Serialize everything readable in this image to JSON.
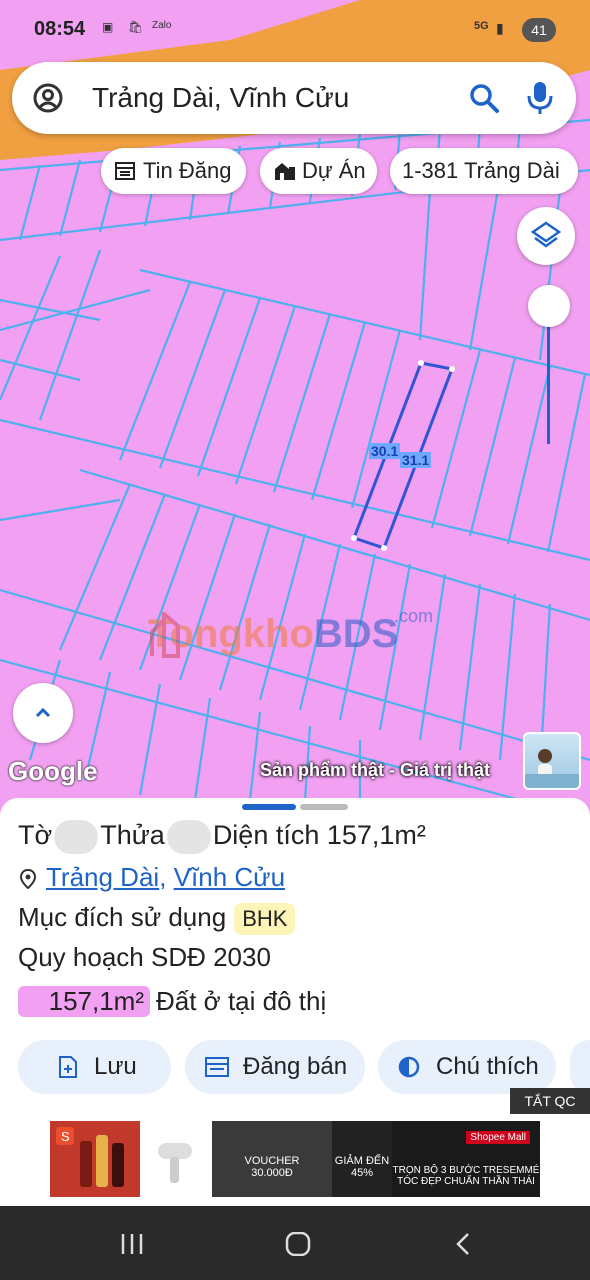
{
  "status_bar": {
    "time": "08:54",
    "notification_icons": [
      "screenshot-icon",
      "shopee-icon",
      "zalo-icon"
    ],
    "signal": "5G",
    "battery": "41"
  },
  "search": {
    "query": "Trảng Dài, Vĩnh Cửu",
    "icons": [
      "account-icon",
      "search-icon",
      "mic-icon"
    ]
  },
  "chips": {
    "tin_dang": "Tin Đăng",
    "du_an": "Dự Án",
    "address": "1-381 Trảng Dài"
  },
  "map": {
    "parcel_labels": [
      "30.1",
      "31.1"
    ],
    "watermark_brand_a": "Tongkho",
    "watermark_brand_b": "BDS",
    "watermark_domain": ".com",
    "google_label": "Google",
    "tagline": "Sản phẩm thật - Giá trị thật",
    "colors": {
      "land": "#f2a0f2",
      "lines": "#4fb0ee",
      "road": "#f0a040",
      "parcel": "#2f55d4"
    }
  },
  "details": {
    "title_to": "Tờ",
    "title_thua": "Thửa",
    "title_area": "Diện tích 157,1m²",
    "location_ward": "Trảng Dài",
    "location_sep": ",",
    "location_district": "Vĩnh Cửu",
    "purpose_label": "Mục đích sử dụng",
    "purpose_code": "BHK",
    "plan_label": "Quy hoạch SDĐ 2030",
    "land_area": "157,1m²",
    "land_type": "Đất ở tại đô thị"
  },
  "actions": {
    "save": "Lưu",
    "post_sale": "Đăng bán",
    "legend": "Chú thích"
  },
  "ad": {
    "close_label": "TẮT QC",
    "voucher_label": "VOUCHER",
    "voucher_value": "30.000Đ",
    "discount_label": "GIẢM ĐẾN",
    "discount_value": "45%",
    "mall_label": "Shopee Mall",
    "promo_line1": "TRỌN BỘ 3 BƯỚC TRESEMMÉ",
    "promo_line2": "TÓC ĐẸP CHUẨN THẦN THÁI"
  }
}
